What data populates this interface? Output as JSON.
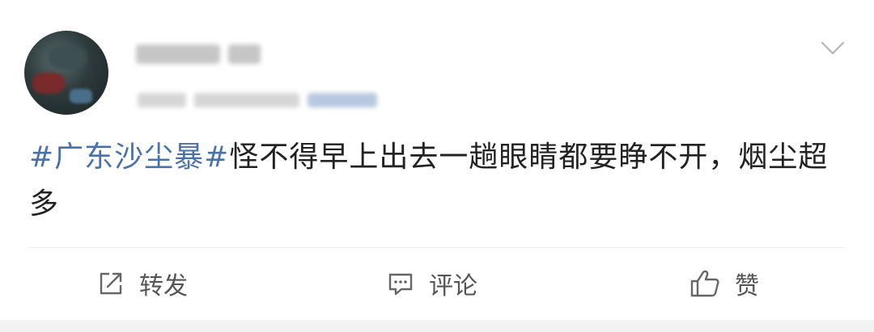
{
  "post": {
    "topic": "#广东沙尘暴#",
    "body": "怪不得早上出去一趟眼睛都要睁不开，烟尘超多"
  },
  "actions": {
    "repost_label": "转发",
    "comment_label": "评论",
    "like_label": "赞"
  },
  "icons": {
    "menu": "chevron-down-icon",
    "repost": "share-icon",
    "comment": "comment-icon",
    "like": "thumbs-up-icon"
  },
  "colors": {
    "topic_link": "#4b72a8",
    "text": "#222222",
    "action_text": "#555555"
  }
}
